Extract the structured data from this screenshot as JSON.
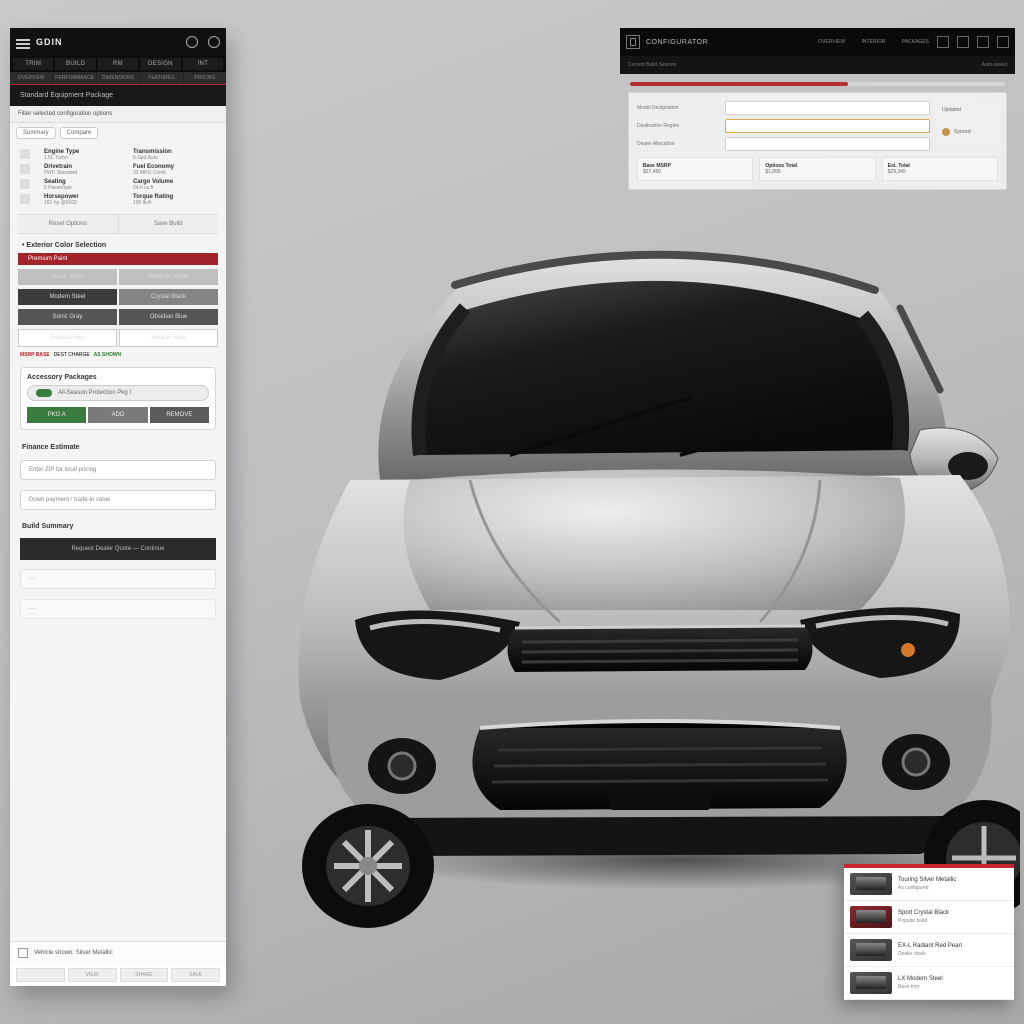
{
  "sidebar": {
    "brand": "GDIN",
    "tabs": [
      "TRIM",
      "BUILD",
      "RM",
      "DESIGN",
      "INT"
    ],
    "subtabs": [
      "OVERVIEW",
      "PERFORMANCE",
      "DIMENSIONS",
      "FEATURES",
      "PRICING"
    ],
    "banner": "Standard Equipment Package",
    "filter_label": "Filter selected configuration options",
    "chips": [
      "Summary",
      "Compare"
    ],
    "specs": [
      {
        "k": "Engine Type",
        "v": "1.5L Turbo",
        "k2": "Transmission",
        "v2": "6-Spd Auto"
      },
      {
        "k": "Drivetrain",
        "v": "FWD Standard",
        "k2": "Fuel Economy",
        "v2": "32 MPG Comb"
      },
      {
        "k": "Seating",
        "v": "5 Passenger",
        "k2": "Cargo Volume",
        "v2": "24.6 cu ft"
      },
      {
        "k": "Horsepower",
        "v": "181 hp @5500",
        "k2": "Torque Rating",
        "v2": "190 lb-ft"
      }
    ],
    "btn_left": "Reset Options",
    "btn_right": "Save Build",
    "trim_heading": "Exterior Color Selection",
    "trim_tag": "Premium Paint",
    "trim_rows": [
      [
        "Lunar Silver",
        "Platinum White"
      ],
      [
        "Modern Steel",
        "Crystal Black"
      ],
      [
        "Sonic Gray",
        "Obsidian Blue"
      ],
      [
        "Radiant Red",
        "Aegean Blue"
      ]
    ],
    "meta_labels": [
      "MSRP BASE",
      "DEST CHARGE",
      "AS SHOWN"
    ],
    "addon_heading": "Accessory Packages",
    "addon_pill": "All-Season Protection Pkg I",
    "addon_cells": [
      "PKG A",
      "ADD",
      "REMOVE"
    ],
    "finance_heading": "Finance Estimate",
    "input_placeholder_1": "Enter ZIP for local pricing",
    "input_placeholder_2": "Down payment / trade-in value",
    "summary_heading": "Build Summary",
    "cta": "Request Dealer Quote — Continue",
    "footer_label": "Vehicle shown: Silver Metallic",
    "bottom": [
      "",
      "VIEW",
      "SHARE",
      "SAVE"
    ]
  },
  "dashboard": {
    "title": "CONFIGURATOR",
    "menu": [
      "OVERVIEW",
      "INTERIOR",
      "PACKAGES"
    ],
    "sub_left": "Current Build Session",
    "sub_right": "Auto-saved",
    "status1": "Updated",
    "status2": "Synced",
    "fields": [
      {
        "label": "Model Designation"
      },
      {
        "label": "Destination Region"
      },
      {
        "label": "Dealer Allocation"
      }
    ],
    "mini": [
      {
        "t": "Base MSRP",
        "s": "$27,450"
      },
      {
        "t": "Options Total",
        "s": "$1,895"
      },
      {
        "t": "Est. Total",
        "s": "$29,345"
      }
    ]
  },
  "variants": {
    "items": [
      {
        "t": "Touring Silver Metallic",
        "s": "As configured"
      },
      {
        "t": "Sport Crystal Black",
        "s": "Popular build"
      },
      {
        "t": "EX-L Radiant Red Pearl",
        "s": "Dealer stock"
      },
      {
        "t": "LX Modern Steel",
        "s": "Base trim"
      }
    ]
  }
}
